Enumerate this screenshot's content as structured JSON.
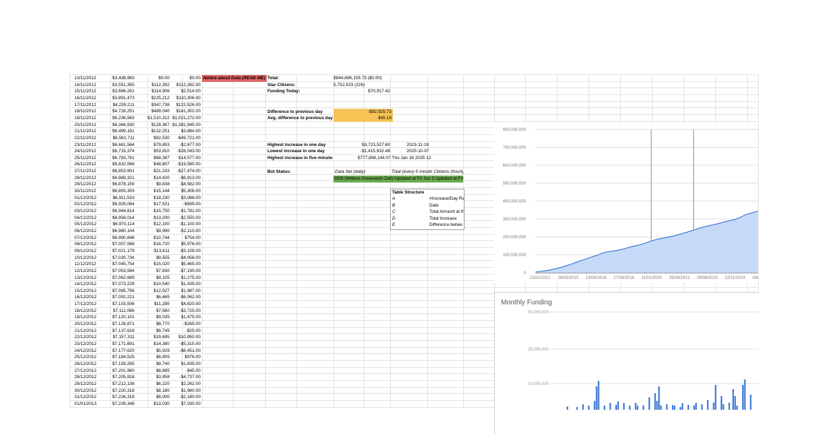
{
  "columns": {
    "dates": [
      "13/11/2012",
      "14/11/2012",
      "15/11/2012",
      "16/11/2012",
      "17/11/2012",
      "18/11/2012",
      "19/11/2012",
      "20/11/2012",
      "21/11/2012",
      "22/11/2012",
      "23/11/2012",
      "24/11/2012",
      "25/11/2012",
      "26/11/2012",
      "27/11/2012",
      "28/11/2012",
      "29/11/2012",
      "30/11/2012",
      "01/12/2012",
      "02/12/2012",
      "03/12/2012",
      "04/12/2012",
      "05/12/2012",
      "06/12/2012",
      "07/12/2012",
      "08/12/2012",
      "09/12/2012",
      "10/12/2012",
      "11/12/2012",
      "12/12/2012",
      "13/12/2012",
      "14/12/2012",
      "15/12/2012",
      "16/12/2012",
      "17/12/2012",
      "18/12/2012",
      "19/12/2012",
      "20/12/2012",
      "21/12/2012",
      "22/12/2012",
      "23/12/2012",
      "24/12/2012",
      "25/12/2012",
      "26/12/2012",
      "27/12/2012",
      "28/12/2012",
      "29/12/2012",
      "30/12/2012",
      "31/12/2012",
      "01/01/2013"
    ],
    "totals": [
      "$3,438,963",
      "$3,551,355",
      "$3,666,261",
      "$3,891,473",
      "$4,239,211",
      "$4,728,251",
      "$6,238,563",
      "$6,366,930",
      "$6,499,181",
      "$6,581,711",
      "$6,661,564",
      "$6,715,374",
      "$6,783,761",
      "$6,832,568",
      "$6,853,901",
      "$6,868,321",
      "$6,878,159",
      "$6,893,303",
      "$6,911,533",
      "$6,929,064",
      "$6,944,814",
      "$6,958,014",
      "$6,970,114",
      "$6,980,104",
      "$6,990,848",
      "$7,007,568",
      "$7,021,179",
      "$7,030,734",
      "$7,045,754",
      "$7,053,584",
      "$7,062,689",
      "$7,073,229",
      "$7,085,756",
      "$7,092,221",
      "$7,103,506",
      "$7,111,066",
      "$7,120,101",
      "$7,128,871",
      "$7,137,616",
      "$7,157,311",
      "$7,171,691",
      "$7,177,620",
      "$7,184,525",
      "$7,193,265",
      "$7,201,960",
      "$7,205,918",
      "$7,212,138",
      "$7,220,318",
      "$7,226,318",
      "$7,239,348"
    ],
    "increases": [
      "$0.00",
      "$112,392",
      "$114,906",
      "$225,212",
      "$347,738",
      "$489,040",
      "$1,510,312",
      "$128,367",
      "$132,251",
      "$82,530",
      "$79,853",
      "$53,810",
      "$68,387",
      "$48,807",
      "$21,333",
      "$14,420",
      "$9,838",
      "$15,144",
      "$18,230",
      "$17,531",
      "$15,750",
      "$13,200",
      "$12,100",
      "$9,990",
      "$10,744",
      "$16,720",
      "$13,611",
      "$9,555",
      "$15,020",
      "$7,830",
      "$9,105",
      "$10,540",
      "$12,527",
      "$6,465",
      "$11,285",
      "$7,560",
      "$9,035",
      "$8,770",
      "$8,745",
      "$19,695",
      "$14,380",
      "$5,929",
      "$6,905",
      "$8,740",
      "$8,695",
      "$3,958",
      "$6,220",
      "$8,180",
      "$6,000",
      "$13,030"
    ],
    "differences": [
      "$0.00",
      "$112,392.00",
      "$2,514.00",
      "$110,306.00",
      "$122,526.00",
      "$141,302.00",
      "$1,021,272.00",
      "-$1,381,945.00",
      "$3,884.00",
      "-$49,721.00",
      "-$2,677.00",
      "-$26,043.00",
      "$14,577.00",
      "-$19,580.00",
      "-$27,474.00",
      "-$6,913.00",
      "-$4,582.00",
      "$5,306.00",
      "$3,086.00",
      "-$699.00",
      "-$1,781.00",
      "-$2,550.00",
      "-$1,100.00",
      "-$2,110.00",
      "$754.00",
      "$5,976.00",
      "-$3,109.00",
      "-$4,056.00",
      "$5,465.00",
      "-$7,190.00",
      "$1,275.00",
      "$1,435.00",
      "$1,987.00",
      "-$6,062.00",
      "$4,820.00",
      "-$3,725.00",
      "$1,475.00",
      "-$265.00",
      "-$25.00",
      "$10,950.00",
      "-$5,315.00",
      "-$8,451.00",
      "$976.00",
      "$1,835.00",
      "-$45.00",
      "-$4,737.00",
      "$2,262.00",
      "$1,960.00",
      "-$2,180.00",
      "$7,030.00"
    ]
  },
  "notice": "Notice about Data (READ ME)",
  "stats": {
    "total_label": "Total:",
    "total_value": "$844,696,155.73 ($0.00)",
    "citizens_label": "Star Citizens:",
    "citizens_value": "5,752,523 (226)",
    "funding_today_label": "Funding Today:",
    "funding_today_value": "$70,917.42",
    "diff_prev_label": "Difference to previous day",
    "diff_prev_value": "-$92,925.73",
    "avg_diff_label": "Avg. difference to previous day",
    "avg_diff_value": "$45.19",
    "highest_day_label": "Highest increase in one day",
    "highest_day_value": "$3,723,527.60",
    "highest_day_date": "2023-11-19",
    "lowest_day_label": "Lowest increase in one day",
    "lowest_day_value": "-$1,415,632.48",
    "lowest_day_date": "2020-10-07",
    "highest_five_label": "Highest increase in five minutes",
    "highest_five_value": "$777,688,144.07 Thu Jan 16 2025 12",
    "bot_status_label": "Bot Status:",
    "data_set_label": "Data Set (daily)",
    "total_every_label": "Total (every 5 minutn Citizens (hourly)",
    "green_bar_text": "0000 (Mittlere Greenwich-Zeit) Updated at Fri Jun 2 Updated at Fri Ju"
  },
  "table_structure": {
    "title": "Table Structure",
    "rows": [
      {
        "k": "A",
        "v": "#Increase/Day Ra"
      },
      {
        "k": "B",
        "v": "Date"
      },
      {
        "k": "C",
        "v": "Total Amount at th"
      },
      {
        "k": "D",
        "v": "Total Increase"
      },
      {
        "k": "E",
        "v": "Difference betwe"
      }
    ]
  },
  "colors": {
    "note": "#e06666",
    "highlight": "#f6c355",
    "status": "#6aa84f",
    "area_fill": "#c6daf8",
    "area_line": "#3c78d8",
    "bars": "#3c78d8"
  },
  "chart_data": [
    {
      "type": "area",
      "title": "",
      "yticks": [
        "800,000,000",
        "700,000,000",
        "600,000,000",
        "500,000,000",
        "400,000,000",
        "300,000,000",
        "200,000,000",
        "100,000,000",
        "0"
      ],
      "xticks": [
        "13/11/2012",
        "28/02/2015",
        "13/06/2016",
        "27/09/2018",
        "11/01/2020",
        "25/04/2021",
        "09/08/2023",
        "22/11/2024",
        "08/"
      ],
      "x": [
        0,
        0.02,
        0.04,
        0.06,
        0.08,
        0.1,
        0.12,
        0.14,
        0.16,
        0.18,
        0.2,
        0.22,
        0.24,
        0.26,
        0.28,
        0.3,
        0.32,
        0.34,
        0.36,
        0.38,
        0.4,
        0.42,
        0.44,
        0.46,
        0.48,
        0.5,
        0.52,
        0.54,
        0.56,
        0.58,
        0.6,
        0.62,
        0.64,
        0.66,
        0.68,
        0.7,
        0.72,
        0.74,
        0.76,
        0.78,
        0.8,
        0.82,
        0.84,
        0.86,
        0.88,
        0.9,
        0.92,
        0.94,
        0.96,
        0.98,
        1
      ],
      "values": [
        4000000,
        7000000,
        10000000,
        14000000,
        20000000,
        25000000,
        32000000,
        40000000,
        48000000,
        57000000,
        66000000,
        74000000,
        83000000,
        91000000,
        99000000,
        109000000,
        116000000,
        120000000,
        123000000,
        128000000,
        134000000,
        142000000,
        148000000,
        153000000,
        160000000,
        168000000,
        177000000,
        185000000,
        190000000,
        195000000,
        200000000,
        205000000,
        212000000,
        219000000,
        226000000,
        234000000,
        242000000,
        250000000,
        257000000,
        263000000,
        268000000,
        274000000,
        281000000,
        288000000,
        292000000,
        299000000,
        309000000,
        322000000,
        330000000,
        337000000,
        344000000
      ],
      "ylim": [
        0,
        800000000
      ]
    },
    {
      "type": "bar",
      "title": "Monthly Funding",
      "yticks": [
        "50,000,000",
        "25,000,000",
        "10,000,000"
      ],
      "x": [
        0.05,
        0.1,
        0.13,
        0.16,
        0.19,
        0.2,
        0.21,
        0.24,
        0.27,
        0.3,
        0.31,
        0.34,
        0.37,
        0.4,
        0.41,
        0.44,
        0.47,
        0.5,
        0.51,
        0.52,
        0.53,
        0.56,
        0.59,
        0.6,
        0.63,
        0.64,
        0.67,
        0.7,
        0.71,
        0.74,
        0.77,
        0.8,
        0.81,
        0.84,
        0.85,
        0.88,
        0.9,
        0.91,
        0.92,
        0.95,
        0.96,
        0.99
      ],
      "values": [
        1.2,
        1,
        2,
        1.5,
        3.2,
        8.5,
        10.5,
        1.5,
        2.5,
        1.8,
        3,
        2.5,
        1.5,
        2.5,
        1.5,
        1.6,
        4.5,
        6,
        3.2,
        8.5,
        1.5,
        2,
        1.7,
        1.5,
        1,
        2.4,
        1.8,
        1.6,
        2.5,
        2,
        3.5,
        2.6,
        9,
        5,
        2,
        2.6,
        7.5,
        5,
        1.5,
        9,
        11,
        5.5
      ],
      "ylim": [
        0,
        60
      ]
    }
  ]
}
